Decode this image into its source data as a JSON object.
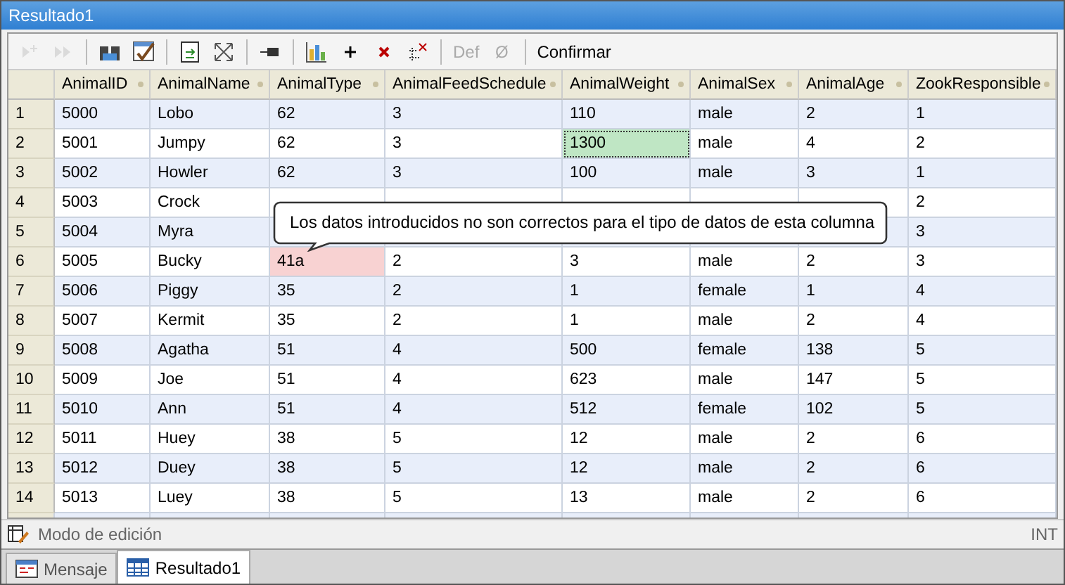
{
  "window": {
    "title": "Resultado1"
  },
  "toolbar": [
    {
      "kind": "append",
      "disabled": true
    },
    {
      "kind": "next",
      "disabled": true
    },
    {
      "kind": "sep"
    },
    {
      "kind": "find",
      "disabled": false
    },
    {
      "kind": "check",
      "disabled": false
    },
    {
      "kind": "sep"
    },
    {
      "kind": "export",
      "disabled": false
    },
    {
      "kind": "expand",
      "disabled": false
    },
    {
      "kind": "sep"
    },
    {
      "kind": "pin",
      "disabled": false
    },
    {
      "kind": "sep"
    },
    {
      "kind": "chart",
      "disabled": false
    },
    {
      "kind": "add",
      "disabled": false
    },
    {
      "kind": "delete",
      "disabled": false
    },
    {
      "kind": "clear",
      "disabled": false
    },
    {
      "kind": "sep"
    },
    {
      "kind": "text",
      "label": "Def",
      "disabled": true
    },
    {
      "kind": "text",
      "label": "Ø",
      "disabled": true
    },
    {
      "kind": "sep"
    },
    {
      "kind": "button",
      "label": "Confirmar",
      "disabled": false
    }
  ],
  "table": {
    "columns": [
      "AnimalID",
      "AnimalName",
      "AnimalType",
      "AnimalFeedSchedule",
      "AnimalWeight",
      "AnimalSex",
      "AnimalAge",
      "ZookResponsible"
    ],
    "rows": [
      {
        "num": "1",
        "cells": [
          "5000",
          "Lobo",
          "62",
          "3",
          "110",
          "male",
          "2",
          "1"
        ]
      },
      {
        "num": "2",
        "cells": [
          "5001",
          "Jumpy",
          "62",
          "3",
          {
            "text": "1300",
            "selected": true
          },
          "male",
          "4",
          "2"
        ]
      },
      {
        "num": "3",
        "cells": [
          "5002",
          "Howler",
          "62",
          "3",
          "100",
          "male",
          "3",
          "1"
        ]
      },
      {
        "num": "4",
        "cells": [
          "5003",
          "Crock",
          null,
          null,
          null,
          null,
          null,
          "2"
        ]
      },
      {
        "num": "5",
        "cells": [
          "5004",
          "Myra",
          null,
          null,
          null,
          null,
          null,
          "3"
        ]
      },
      {
        "num": "6",
        "cells": [
          "5005",
          "Bucky",
          {
            "text": "41a",
            "error": true
          },
          "2",
          "3",
          "male",
          "2",
          "3"
        ]
      },
      {
        "num": "7",
        "cells": [
          "5006",
          "Piggy",
          "35",
          "2",
          "1",
          "female",
          "1",
          "4"
        ]
      },
      {
        "num": "8",
        "cells": [
          "5007",
          "Kermit",
          "35",
          "2",
          "1",
          "male",
          "2",
          "4"
        ]
      },
      {
        "num": "9",
        "cells": [
          "5008",
          "Agatha",
          "51",
          "4",
          "500",
          "female",
          "138",
          "5"
        ]
      },
      {
        "num": "10",
        "cells": [
          "5009",
          "Joe",
          "51",
          "4",
          "623",
          "male",
          "147",
          "5"
        ]
      },
      {
        "num": "11",
        "cells": [
          "5010",
          "Ann",
          "51",
          "4",
          "512",
          "female",
          "102",
          "5"
        ]
      },
      {
        "num": "12",
        "cells": [
          "5011",
          "Huey",
          "38",
          "5",
          "12",
          "male",
          "2",
          "6"
        ]
      },
      {
        "num": "13",
        "cells": [
          "5012",
          "Duey",
          "38",
          "5",
          "12",
          "male",
          "2",
          "6"
        ]
      },
      {
        "num": "14",
        "cells": [
          "5013",
          "Luey",
          "38",
          "5",
          "13",
          "male",
          "2",
          "6"
        ]
      }
    ]
  },
  "tooltip": {
    "text": "Los datos introducidos no son correctos para el tipo de datos de esta columna"
  },
  "status_bar": {
    "mode": "Modo de edición",
    "type": "INT"
  },
  "bottom_tabs": [
    {
      "label": "Mensaje",
      "selected": false,
      "kind": "message"
    },
    {
      "label": "Resultado1",
      "selected": true,
      "kind": "grid"
    }
  ]
}
